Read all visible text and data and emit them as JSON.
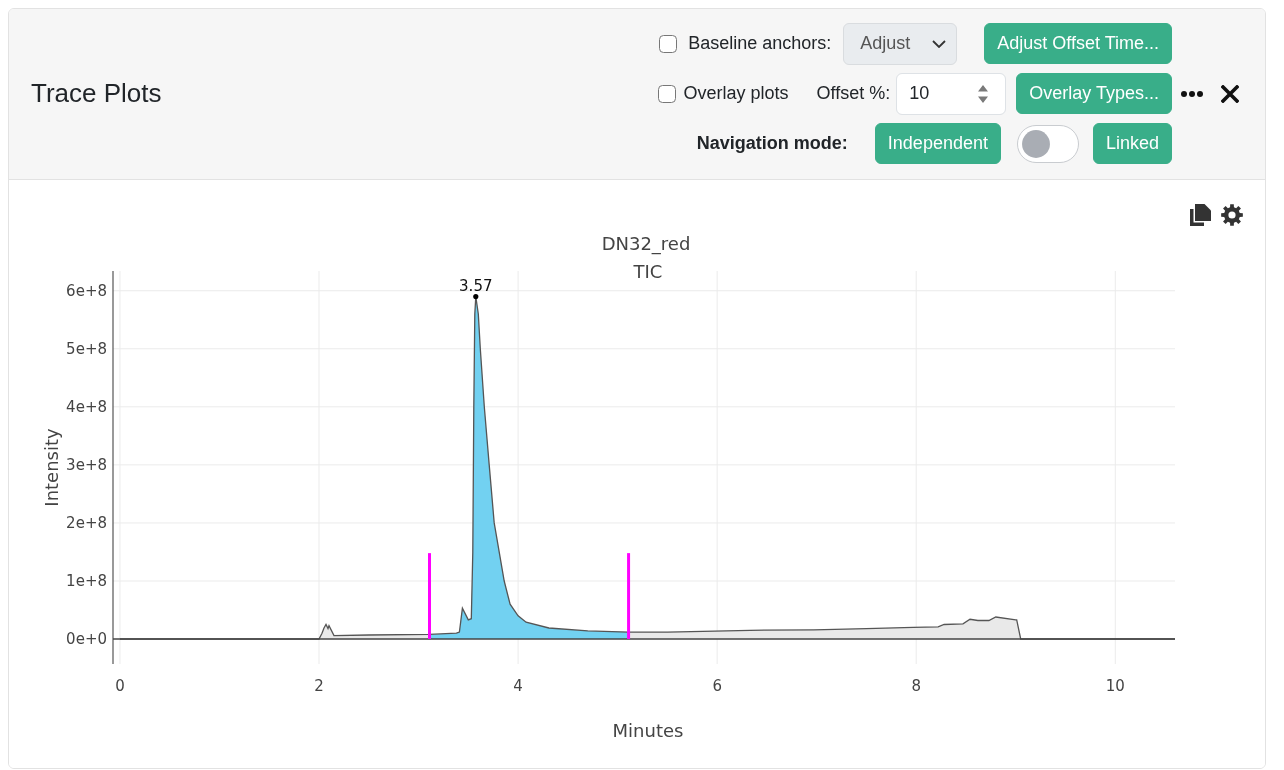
{
  "panel": {
    "title": "Trace Plots"
  },
  "toolbar": {
    "baseline_anchors": {
      "label": "Baseline anchors:",
      "checked": false
    },
    "anchor_mode": {
      "value": "Adjust",
      "disabled": true
    },
    "adjust_offset_button": {
      "label": "Adjust Offset Time..."
    },
    "overlay_plots": {
      "label": "Overlay plots",
      "checked": false
    },
    "offset": {
      "label": "Offset %:",
      "value": "10"
    },
    "overlay_types_button": {
      "label": "Overlay Types..."
    },
    "navigation_mode": {
      "label": "Navigation mode:",
      "independent_button": "Independent",
      "linked": false,
      "linked_button": "Linked"
    }
  },
  "plot": {
    "chart_data": {
      "type": "area",
      "title": "DN32_red",
      "xlabel": "Minutes",
      "ylabel": "Intensity",
      "x": [
        0,
        2.0,
        2.03,
        2.05,
        2.07,
        2.09,
        2.1,
        2.15,
        2.5,
        3.11,
        3.38,
        3.41,
        3.44,
        3.5,
        3.53,
        3.545,
        3.555,
        3.565,
        3.575,
        3.6,
        3.62,
        3.66,
        3.71,
        3.76,
        3.86,
        3.92,
        4.0,
        4.08,
        4.31,
        4.7,
        5.11,
        5.5,
        6.33,
        6.97,
        7.5,
        7.97,
        8.22,
        8.28,
        8.47,
        8.54,
        8.62,
        8.73,
        8.8,
        9.0,
        9.01,
        9.05,
        10.6
      ],
      "series": [
        {
          "name": "TIC",
          "color": "#e9e9e9",
          "values": [
            0,
            0,
            10000000,
            19000000,
            25000000,
            18000000,
            23000000,
            6000000,
            7000000,
            8000000,
            10000000,
            12000000,
            53000000,
            33000000,
            35000000,
            150000000,
            400000000,
            560000000,
            590000000,
            560000000,
            500000000,
            400000000,
            300000000,
            200000000,
            100000000,
            60000000,
            40000000,
            29000000,
            19000000,
            14000000,
            12000000,
            12000000,
            15000000,
            16000000,
            18000000,
            20000000,
            21000000,
            25000000,
            26000000,
            34000000,
            32000000,
            32000000,
            38000000,
            33000000,
            33000000,
            0,
            0
          ]
        },
        {
          "color": "#72d1f1",
          "values": [
            null,
            null,
            null,
            null,
            null,
            null,
            null,
            null,
            null,
            8000000,
            10000000,
            12000000,
            53000000,
            33000000,
            35000000,
            150000000,
            400000000,
            560000000,
            590000000,
            560000000,
            500000000,
            400000000,
            300000000,
            200000000,
            100000000,
            60000000,
            40000000,
            29000000,
            19000000,
            14000000,
            12000000,
            null,
            null,
            null,
            null,
            null,
            null,
            null,
            null,
            null,
            null,
            null,
            null,
            null,
            null,
            null,
            null
          ]
        }
      ],
      "xlim": [
        -0.07,
        10.6
      ],
      "ylim": [
        -43000000,
        634000000
      ],
      "xticks": [
        0,
        2,
        4,
        6,
        8,
        10
      ],
      "yticks": [
        {
          "value": 0,
          "label": "0e+0"
        },
        {
          "value": 100000000,
          "label": "1e+8"
        },
        {
          "value": 200000000,
          "label": "2e+8"
        },
        {
          "value": 300000000,
          "label": "3e+8"
        },
        {
          "value": 400000000,
          "label": "4e+8"
        },
        {
          "value": 500000000,
          "label": "5e+8"
        },
        {
          "value": 600000000,
          "label": "6e+8"
        }
      ],
      "grid": true,
      "ref_lines": [
        {
          "axis": "x",
          "value": 3.11,
          "color": "#ff00ff"
        },
        {
          "axis": "x",
          "value": 5.11,
          "color": "#ff00ff"
        }
      ],
      "annotations": [
        {
          "x": 3.575,
          "y": 590000000,
          "text": "3.57"
        }
      ]
    }
  }
}
